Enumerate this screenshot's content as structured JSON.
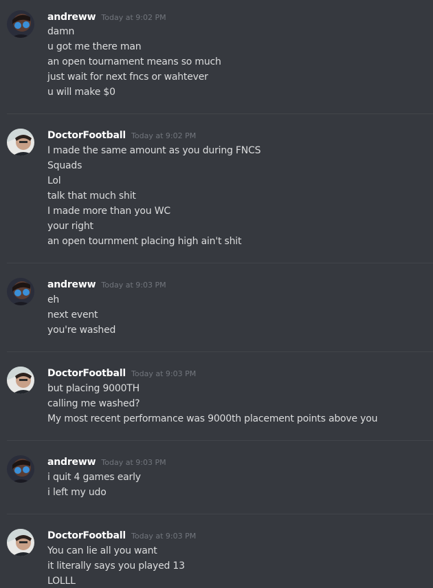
{
  "messages": [
    {
      "username": "andreww",
      "timestamp": "Today at 9:02 PM",
      "lines": [
        "damn",
        "u got me there man",
        "an open tournament means so much",
        "just wait for next fncs or wahtever",
        "u will make $0"
      ]
    },
    {
      "username": "DoctorFootball",
      "timestamp": "Today at 9:02 PM",
      "lines": [
        "I made the same amount as you during FNCS",
        "Squads",
        "Lol",
        "talk that much shit",
        "I made more than you WC",
        "your right",
        "an open tournment placing high ain't shit"
      ]
    },
    {
      "username": "andreww",
      "timestamp": "Today at 9:03 PM",
      "lines": [
        "eh",
        "next event",
        "you're washed"
      ]
    },
    {
      "username": "DoctorFootball",
      "timestamp": "Today at 9:03 PM",
      "lines": [
        "but placing 9000TH",
        "calling me washed?",
        "My most recent performance was 9000th placement points above you"
      ]
    },
    {
      "username": "andreww",
      "timestamp": "Today at 9:03 PM",
      "lines": [
        "i quit 4 games early",
        "i left my udo"
      ]
    },
    {
      "username": "DoctorFootball",
      "timestamp": "Today at 9:03 PM",
      "lines": [
        "You can lie all you want",
        "it literally says you played 13",
        "LOLLL"
      ]
    }
  ]
}
